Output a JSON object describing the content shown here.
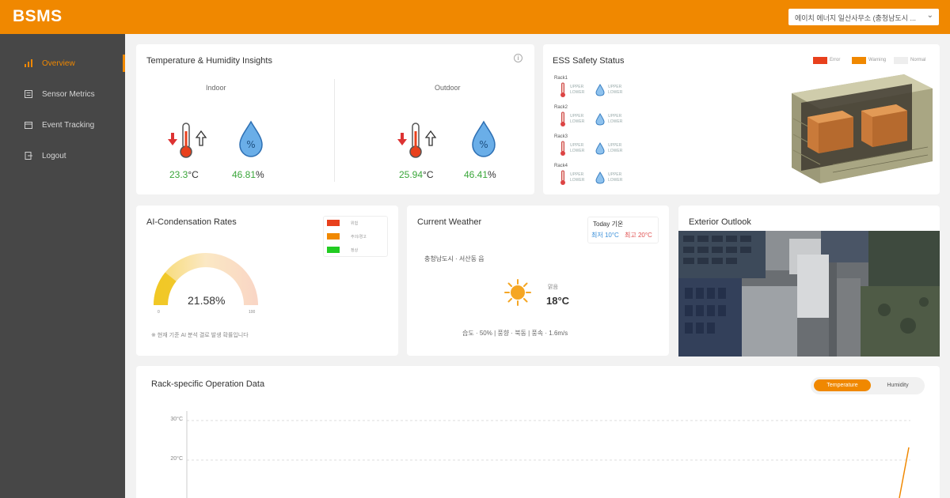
{
  "app": {
    "logo_text": "BSMS",
    "site_selector": "에이치 에너지 일산사무소 (충청남도시 ..."
  },
  "sidebar": {
    "items": [
      {
        "label": "Overview",
        "icon": "chart-icon",
        "active": true
      },
      {
        "label": "Sensor Metrics",
        "icon": "list-icon",
        "active": false
      },
      {
        "label": "Event Tracking",
        "icon": "calendar-icon",
        "active": false
      },
      {
        "label": "Logout",
        "icon": "logout-icon",
        "active": false
      }
    ]
  },
  "temp_humidity": {
    "title": "Temperature & Humidity Insights",
    "indoor": {
      "label": "Indoor",
      "temperature": "23.3",
      "humidity": "46.81"
    },
    "outdoor": {
      "label": "Outdoor",
      "temperature": "25.94",
      "humidity": "46.41"
    },
    "temp_unit": "°C",
    "humidity_unit": "%"
  },
  "ess": {
    "title": "ESS Safety Status",
    "legend": [
      {
        "label": "Error",
        "color": "#e8401c"
      },
      {
        "label": "Warning",
        "color": "#f08800"
      },
      {
        "label": "Normal",
        "color": "#eeeeee"
      }
    ],
    "racks": [
      "Rack1",
      "Rack2",
      "Rack3",
      "Rack4"
    ],
    "upper": "UPPER",
    "lower": "LOWER"
  },
  "condensation": {
    "title": "AI-Condensation Rates",
    "value": "21.58%",
    "value_fraction": 0.2158,
    "scale_min": "0",
    "scale_max": "100",
    "legend": [
      {
        "label": "위험",
        "color": "#e8401c"
      },
      {
        "label": "주의/경고",
        "color": "#f08800"
      },
      {
        "label": "정상",
        "color": "#22cc22"
      }
    ],
    "note": "※ 현재 기준 AI 분석 결로 발생 확률입니다"
  },
  "weather": {
    "title": "Current Weather",
    "today_label": "Today 기온",
    "today_low": "최저 10°C",
    "today_high": "최고 20°C",
    "location": "충청남도시 · 서산동 읍",
    "condition": "맑음",
    "temperature": "18°C",
    "stats": "습도 · 50%  |  풍향 · 북동  |  풍속 · 1.6m/s"
  },
  "exterior": {
    "title": "Exterior Outlook"
  },
  "rack_chart": {
    "title": "Rack-specific Operation Data",
    "toggle_active": "Temperature",
    "toggle_inactive": "Humidity",
    "y_ticks": [
      "30°C",
      "20°C"
    ]
  }
}
